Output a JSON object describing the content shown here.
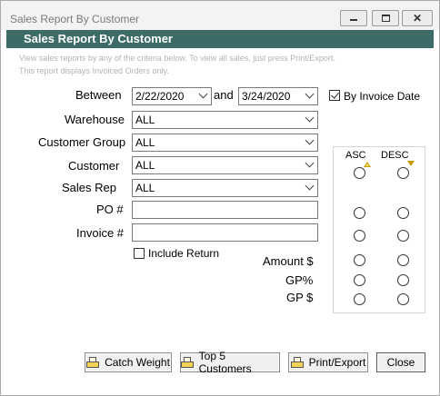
{
  "window": {
    "title": "Sales Report By Customer"
  },
  "header": {
    "title": "Sales Report By Customer",
    "info_line1": "View sales reports by any of the criteria below.  To view all sales, just press Print/Export.",
    "info_line2": "This report displays Invoiced Orders only."
  },
  "form": {
    "between_label": "Between",
    "date_from": "2/22/2020",
    "and_label": "and",
    "date_to": "3/24/2020",
    "by_invoice_date_label": "By Invoice Date",
    "by_invoice_date_checked": true,
    "warehouse_label": "Warehouse",
    "warehouse_value": "ALL",
    "customer_group_label": "Customer Group",
    "customer_group_value": "ALL",
    "customer_label": "Customer",
    "customer_value": "ALL",
    "sales_rep_label": "Sales Rep",
    "sales_rep_value": "ALL",
    "po_label": "PO #",
    "po_value": "",
    "invoice_label": "Invoice #",
    "invoice_value": "",
    "include_return_label": "Include Return",
    "include_return_checked": false
  },
  "sort": {
    "asc_label": "ASC",
    "desc_label": "DESC",
    "amount_label": "Amount $",
    "gp_pct_label": "GP%",
    "gp_amt_label": "GP $",
    "accent_color": "#c49a00"
  },
  "buttons": {
    "catch_weight": "Catch Weight",
    "top5": "Top 5 Customers",
    "print_export": "Print/Export",
    "close": "Close"
  },
  "colors": {
    "header_band": "#3d6b67"
  }
}
